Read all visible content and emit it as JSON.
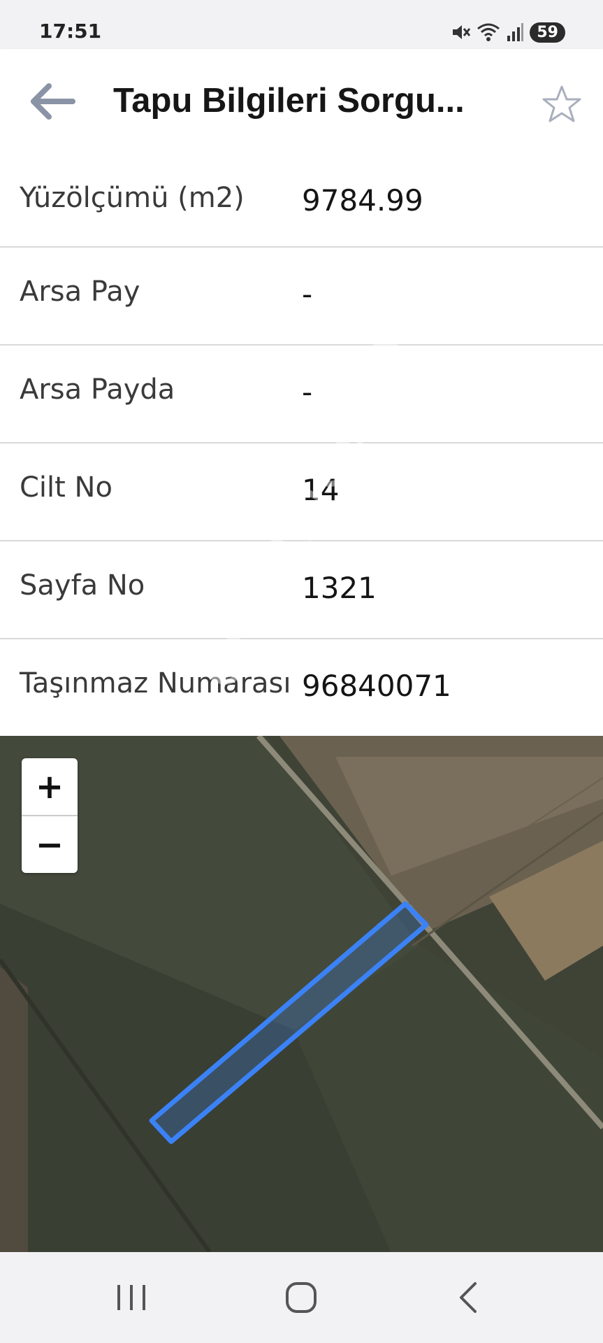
{
  "status_bar": {
    "time": "17:51",
    "battery": "59",
    "icons": [
      "mute-icon",
      "wifi-icon",
      "signal-icon"
    ]
  },
  "app_bar": {
    "title": "Tapu Bilgileri Sorgu...",
    "back_icon": "arrow-left-icon",
    "favorite_icon": "star-outline-icon"
  },
  "info_rows": [
    {
      "label": "Yüzölçümü (m2)",
      "value": "9784.99"
    },
    {
      "label": "Arsa Pay",
      "value": "-"
    },
    {
      "label": "Arsa Payda",
      "value": "-"
    },
    {
      "label": "Cilt No",
      "value": "14"
    },
    {
      "label": "Sayfa No",
      "value": "1321"
    },
    {
      "label": "Taşınmaz Numarası",
      "value": "96840071"
    }
  ],
  "map": {
    "zoom_in_label": "+",
    "zoom_out_label": "−",
    "parcel_color": "#3b82f6",
    "watermark": "emlakjet.com"
  },
  "nav_bar": {
    "icons": [
      "recent-apps-icon",
      "home-icon",
      "back-icon"
    ]
  },
  "colors": {
    "app_bar_bg": "#ffffff",
    "page_bg": "#f2f2f4",
    "divider": "#d9d9d9"
  }
}
